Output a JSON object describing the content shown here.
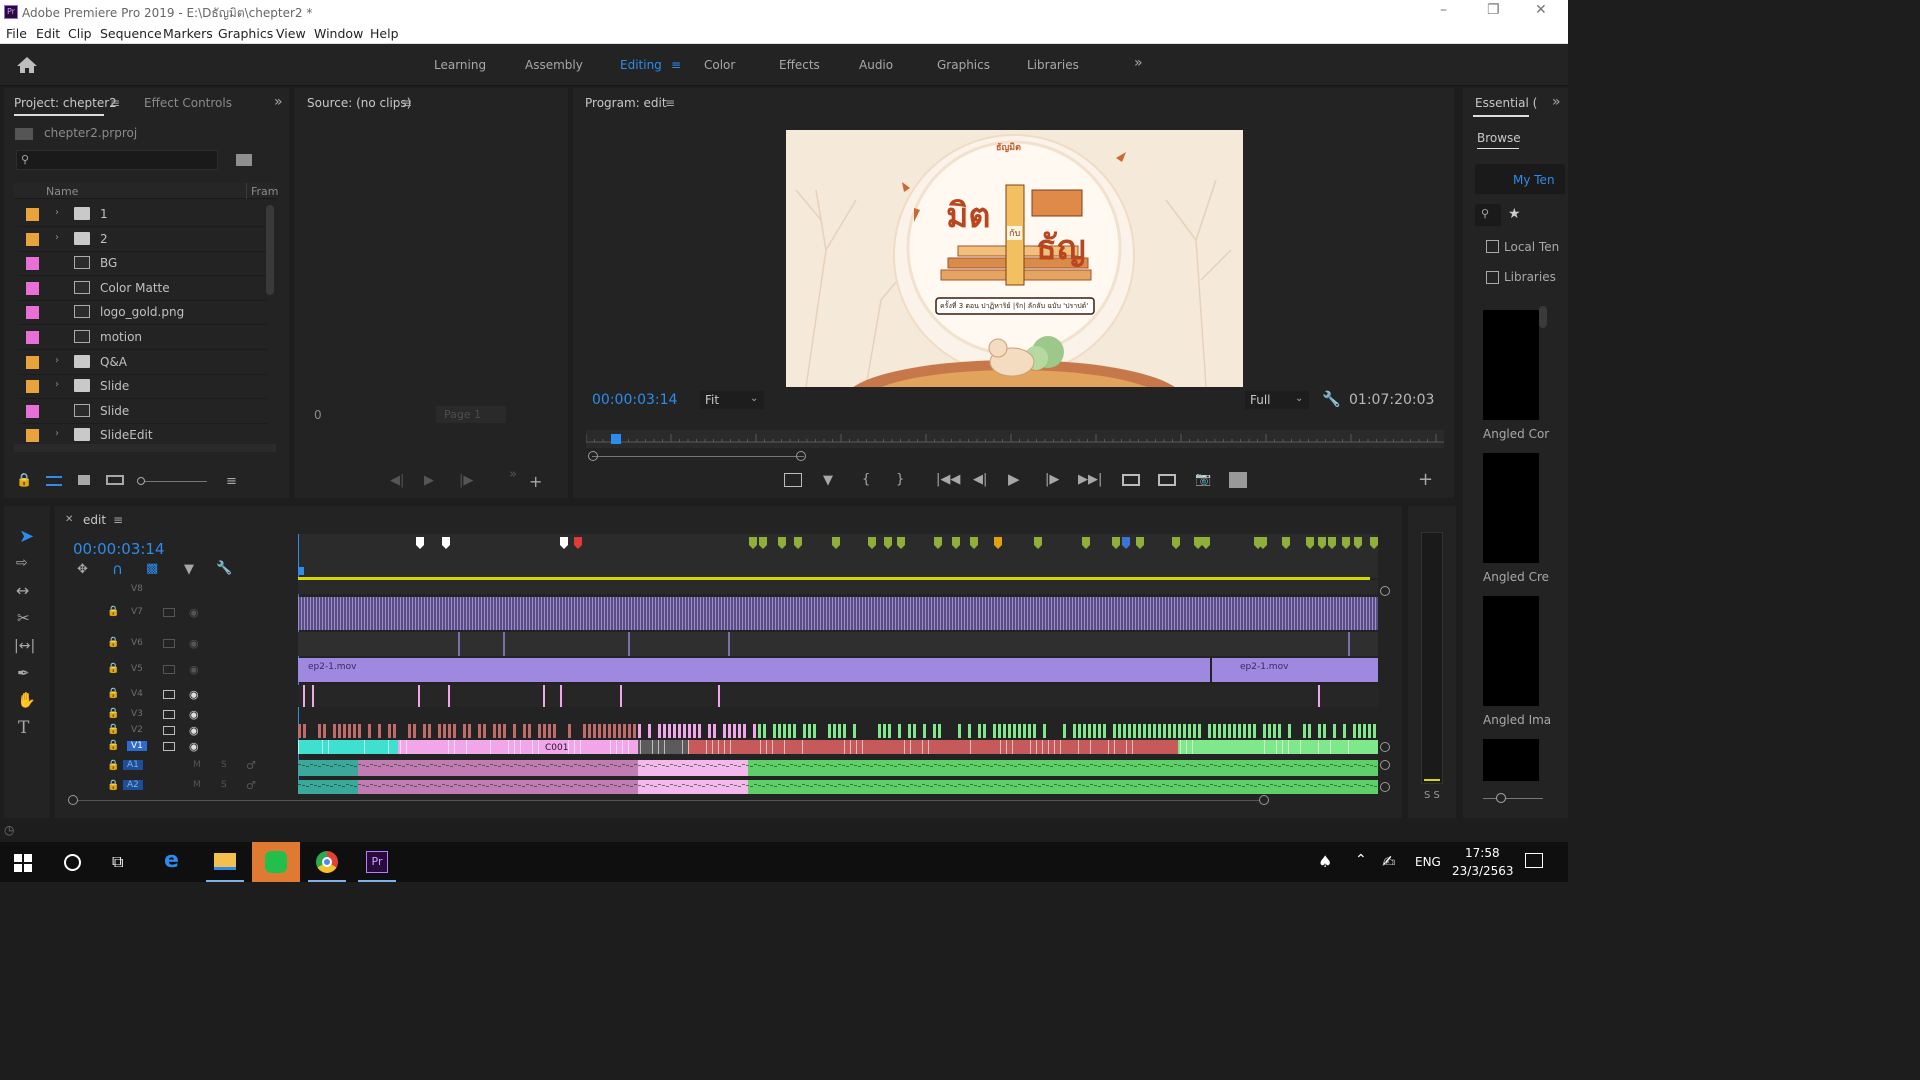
{
  "window": {
    "title": "Adobe Premiere Pro 2019 - E:\\Dธัญมิต\\chepter2 *",
    "app_icon_text": "Pr"
  },
  "menu": [
    "File",
    "Edit",
    "Clip",
    "Sequence",
    "Markers",
    "Graphics",
    "View",
    "Window",
    "Help"
  ],
  "workspaces": {
    "items": [
      "Learning",
      "Assembly",
      "Editing",
      "Color",
      "Effects",
      "Audio",
      "Graphics",
      "Libraries"
    ],
    "active": "Editing"
  },
  "project_panel": {
    "tab_project": "Project: chepter2",
    "tab_effect_controls": "Effect Controls",
    "project_file": "chepter2.prproj",
    "search_placeholder": "",
    "col_name": "Name",
    "col_frame": "Fram",
    "items": [
      {
        "name": "1",
        "type": "folder",
        "color": "#e8a33a",
        "expandable": true
      },
      {
        "name": "2",
        "type": "folder",
        "color": "#e8a33a",
        "expandable": true
      },
      {
        "name": "BG",
        "type": "sequence",
        "color": "#e86fd8",
        "expandable": false
      },
      {
        "name": "Color Matte",
        "type": "sequence",
        "color": "#e86fd8",
        "expandable": false
      },
      {
        "name": "logo_gold.png",
        "type": "sequence",
        "color": "#e86fd8",
        "expandable": false
      },
      {
        "name": "motion",
        "type": "sequence",
        "color": "#e86fd8",
        "expandable": false
      },
      {
        "name": "Q&A",
        "type": "folder",
        "color": "#e8a33a",
        "expandable": true
      },
      {
        "name": "Slide",
        "type": "folder",
        "color": "#e8a33a",
        "expandable": true
      },
      {
        "name": "Slide",
        "type": "sequence",
        "color": "#e86fd8",
        "expandable": false
      },
      {
        "name": "SlideEdit",
        "type": "folder",
        "color": "#e8a33a",
        "expandable": true
      }
    ]
  },
  "source_panel": {
    "title": "Source: (no clips)",
    "timecode": "0",
    "page_label": "Page 1"
  },
  "program_panel": {
    "title": "Program: edit",
    "timecode": "00:00:03:14",
    "fit_label": "Fit",
    "quality_label": "Full",
    "duration": "01:07:20:03",
    "frame_title_small": "ธัญมิต",
    "frame_title_big1": "มิต",
    "frame_title_mid": "กับ",
    "frame_title_big2": "ธัญ",
    "frame_subtitle": "ครั้งที่ 3 ตอน ปาฏิหาริย์ |รัก| ลักลับ ฉบับ 'ปราปต์'"
  },
  "essential_panel": {
    "title": "Essential (",
    "tab_browse": "Browse",
    "my_templates": "My Ten",
    "local_templates": "Local Ten",
    "libraries": "Libraries",
    "templates": [
      "Angled Cor",
      "Angled Cre",
      "Angled Ima"
    ]
  },
  "timeline": {
    "sequence_name": "edit",
    "timecode": "00:00:03:14",
    "video_tracks": [
      "V8",
      "V7",
      "V6",
      "V5",
      "V4",
      "V3",
      "V2",
      "V1"
    ],
    "audio_tracks": [
      "A1",
      "A2"
    ],
    "clip_v5_a": "ep2-1.mov",
    "clip_v5_b": "ep2-1.mov",
    "clip_v1": "C001",
    "audio_meter_labels": "S S",
    "track_mute": "M",
    "track_solo": "S"
  },
  "taskbar": {
    "lang": "ENG",
    "time": "17:58",
    "date": "23/3/2563"
  },
  "colors": {
    "accent_blue": "#2d8ceb",
    "folder_orange": "#e8a33a",
    "seq_pink": "#e86fd8",
    "clip_purple": "#9f88e0",
    "clip_pink": "#f0a6e8",
    "clip_green": "#7ee88a",
    "clip_red": "#c65a5a",
    "clip_cyan": "#3fe0d0"
  }
}
